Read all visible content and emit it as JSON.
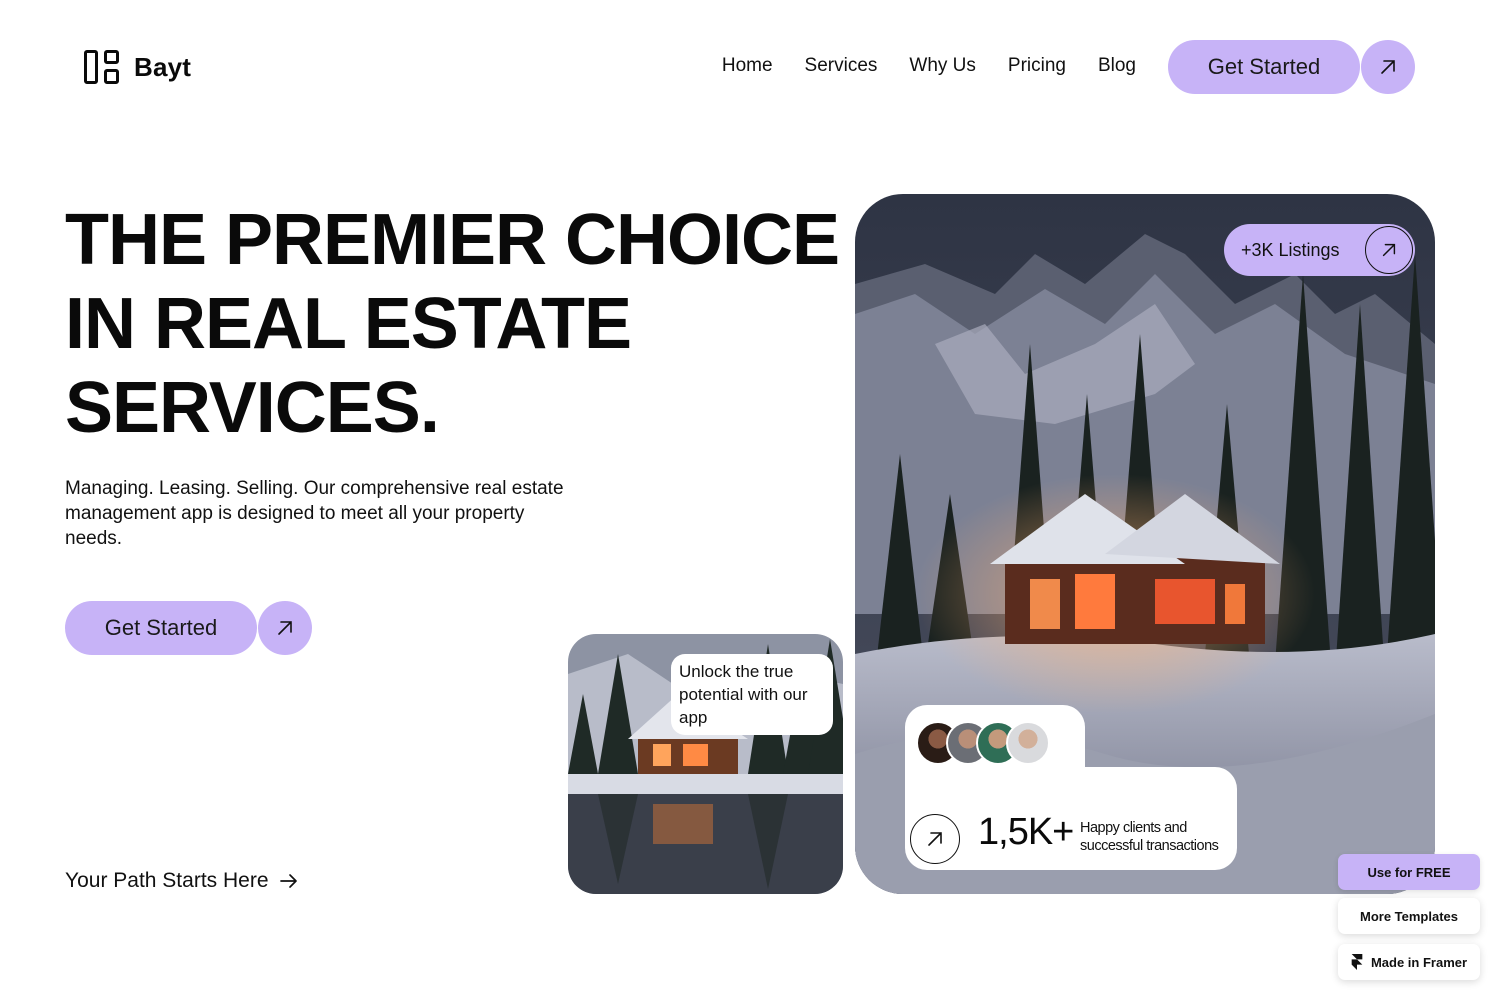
{
  "header": {
    "logo_text": "Bayt",
    "nav": [
      "Home",
      "Services",
      "Why Us",
      "Pricing",
      "Blog"
    ],
    "cta_label": "Get Started"
  },
  "hero": {
    "title_lines": [
      "THE PREMIER CHOICE",
      "IN REAL ESTATE",
      "SERVICES."
    ],
    "subtitle": "Managing. Leasing. Selling. Our comprehensive real estate management app is designed to meet all your property needs.",
    "cta_label": "Get Started",
    "path_link": "Your Path Starts Here"
  },
  "gallery": {
    "listings_label": "+3K Listings",
    "bubble_text": "Unlock the true potential with our app",
    "stats_value": "1,5K+",
    "stats_label": "Happy clients and successful transactions"
  },
  "framer": {
    "use_free": "Use for FREE",
    "more_templates": "More Templates",
    "made_in": "Made in Framer"
  },
  "colors": {
    "accent": "#c7b3f7",
    "text": "#0a0a0a"
  },
  "icons": [
    "logo-icon",
    "arrow-up-right-icon",
    "arrow-right-icon",
    "framer-icon"
  ]
}
